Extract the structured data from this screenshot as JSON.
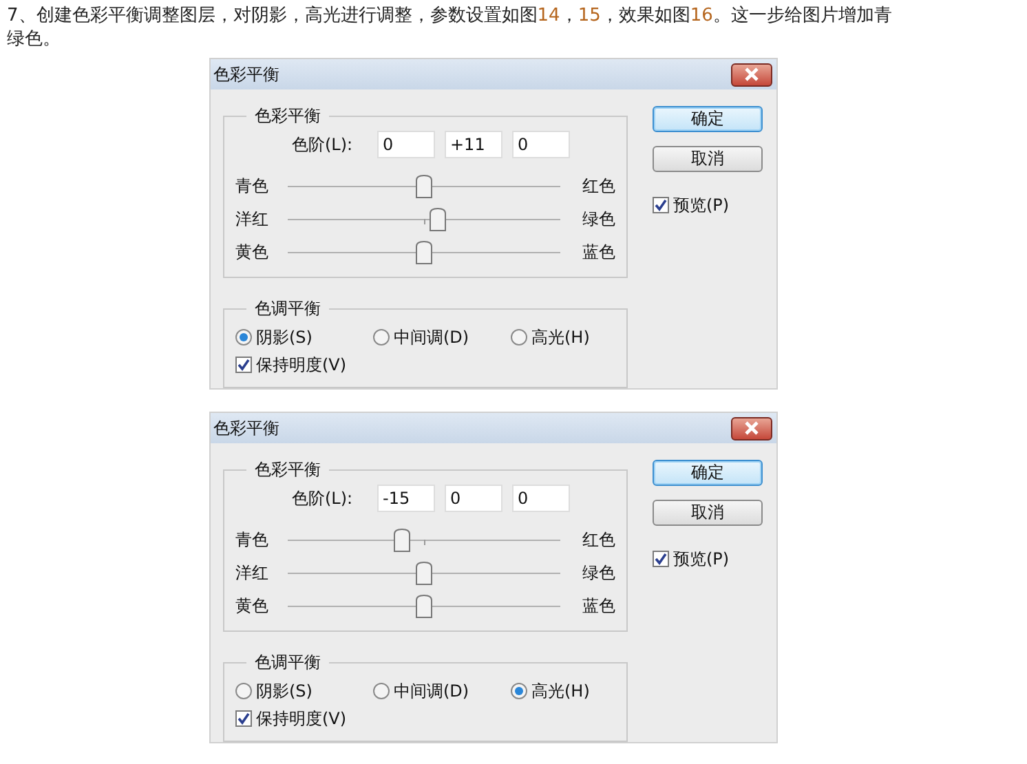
{
  "intro": {
    "segments": [
      {
        "text": "7、创建色彩平衡调整图层，对阴影，高光进行调整，参数设置如图",
        "highlight": false
      },
      {
        "text": "14",
        "highlight": true
      },
      {
        "text": "，",
        "highlight": false
      },
      {
        "text": "15",
        "highlight": true
      },
      {
        "text": "，效果如图",
        "highlight": false
      },
      {
        "text": "16",
        "highlight": true
      },
      {
        "text": "。这一步给图片增加青绿色。",
        "highlight": false
      }
    ]
  },
  "dialogs": [
    {
      "title": "色彩平衡",
      "color_group": {
        "title": "色彩平衡",
        "levels_label": "色阶(L):",
        "levels": [
          "0",
          "+11",
          "0"
        ],
        "sliders": [
          {
            "left": "青色",
            "right": "红色",
            "level": 0.5
          },
          {
            "left": "洋红",
            "right": "绿色",
            "level": 0.55
          },
          {
            "left": "黄色",
            "right": "蓝色",
            "level": 0.5
          }
        ]
      },
      "tone_group": {
        "title": "色调平衡",
        "options": [
          {
            "label": "阴影(S)",
            "selected": true
          },
          {
            "label": "中间调(D)",
            "selected": false
          },
          {
            "label": "高光(H)",
            "selected": false
          }
        ],
        "preserve": {
          "label": "保持明度(V)",
          "checked": true
        }
      },
      "buttons": [
        {
          "label": "确定",
          "default": true
        },
        {
          "label": "取消",
          "default": false
        }
      ],
      "preview": {
        "label": "预览(P)",
        "checked": true
      }
    },
    {
      "title": "色彩平衡",
      "color_group": {
        "title": "色彩平衡",
        "levels_label": "色阶(L):",
        "levels": [
          "-15",
          "0",
          "0"
        ],
        "sliders": [
          {
            "left": "青色",
            "right": "红色",
            "level": 0.42
          },
          {
            "left": "洋红",
            "right": "绿色",
            "level": 0.5
          },
          {
            "left": "黄色",
            "right": "蓝色",
            "level": 0.5
          }
        ]
      },
      "tone_group": {
        "title": "色调平衡",
        "options": [
          {
            "label": "阴影(S)",
            "selected": false
          },
          {
            "label": "中间调(D)",
            "selected": false
          },
          {
            "label": "高光(H)",
            "selected": true
          }
        ],
        "preserve": {
          "label": "保持明度(V)",
          "checked": true
        }
      },
      "buttons": [
        {
          "label": "确定",
          "default": true
        },
        {
          "label": "取消",
          "default": false
        }
      ],
      "preview": {
        "label": "预览(P)",
        "checked": true
      }
    }
  ]
}
